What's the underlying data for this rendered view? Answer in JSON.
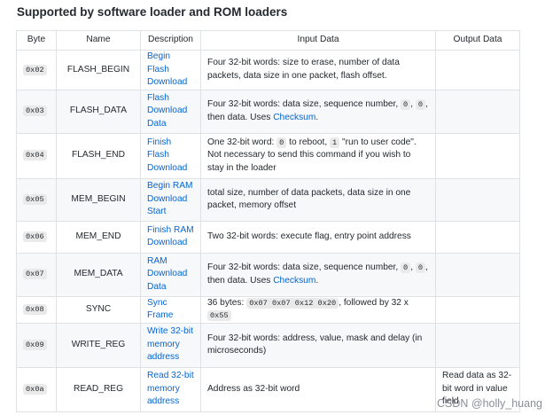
{
  "heading": "Supported by software loader and ROM loaders",
  "columns": {
    "byte": "Byte",
    "name": "Name",
    "description": "Description",
    "input": "Input Data",
    "output": "Output Data"
  },
  "rows": [
    {
      "byte": "0x02",
      "name": "FLASH_BEGIN",
      "desc": "Begin Flash Download",
      "input": [
        {
          "t": "text",
          "v": "Four 32-bit words: size to erase, number of data packets, data size in one packet, flash offset."
        }
      ],
      "output": ""
    },
    {
      "byte": "0x03",
      "name": "FLASH_DATA",
      "desc": "Flash Download Data",
      "input": [
        {
          "t": "text",
          "v": "Four 32-bit words: data size, sequence number, "
        },
        {
          "t": "code",
          "v": "0"
        },
        {
          "t": "text",
          "v": ", "
        },
        {
          "t": "code",
          "v": "0"
        },
        {
          "t": "text",
          "v": ", then data. Uses "
        },
        {
          "t": "link",
          "v": "Checksum"
        },
        {
          "t": "text",
          "v": "."
        }
      ],
      "output": ""
    },
    {
      "byte": "0x04",
      "name": "FLASH_END",
      "desc": "Finish Flash Download",
      "input": [
        {
          "t": "text",
          "v": "One 32-bit word: "
        },
        {
          "t": "code",
          "v": "0"
        },
        {
          "t": "text",
          "v": " to reboot, "
        },
        {
          "t": "code",
          "v": "1"
        },
        {
          "t": "text",
          "v": " \"run to user code\". Not necessary to send this command if you wish to stay in the loader"
        }
      ],
      "output": ""
    },
    {
      "byte": "0x05",
      "name": "MEM_BEGIN",
      "desc": "Begin RAM Download Start",
      "input": [
        {
          "t": "text",
          "v": "total size, number of data packets, data size in one packet, memory offset"
        }
      ],
      "output": ""
    },
    {
      "byte": "0x06",
      "name": "MEM_END",
      "desc": "Finish RAM Download",
      "input": [
        {
          "t": "text",
          "v": "Two 32-bit words: execute flag, entry point address"
        }
      ],
      "output": ""
    },
    {
      "byte": "0x07",
      "name": "MEM_DATA",
      "desc": "RAM Download Data",
      "input": [
        {
          "t": "text",
          "v": "Four 32-bit words: data size, sequence number, "
        },
        {
          "t": "code",
          "v": "0"
        },
        {
          "t": "text",
          "v": ", "
        },
        {
          "t": "code",
          "v": "0"
        },
        {
          "t": "text",
          "v": ", then data. Uses "
        },
        {
          "t": "link",
          "v": "Checksum"
        },
        {
          "t": "text",
          "v": "."
        }
      ],
      "output": ""
    },
    {
      "byte": "0x08",
      "name": "SYNC",
      "desc": "Sync Frame",
      "input": [
        {
          "t": "text",
          "v": "36 bytes: "
        },
        {
          "t": "code",
          "v": "0x07 0x07 0x12 0x20"
        },
        {
          "t": "text",
          "v": ", followed by 32 x "
        },
        {
          "t": "code",
          "v": "0x55"
        }
      ],
      "output": ""
    },
    {
      "byte": "0x09",
      "name": "WRITE_REG",
      "desc": "Write 32-bit memory address",
      "input": [
        {
          "t": "text",
          "v": "Four 32-bit words: address, value, mask and delay (in microseconds)"
        }
      ],
      "output": ""
    },
    {
      "byte": "0x0a",
      "name": "READ_REG",
      "desc": "Read 32-bit memory address",
      "input": [
        {
          "t": "text",
          "v": "Address as 32-bit word"
        }
      ],
      "output": "Read data as 32-bit word in value field"
    }
  ],
  "watermark": "CSDN @holly_huang"
}
